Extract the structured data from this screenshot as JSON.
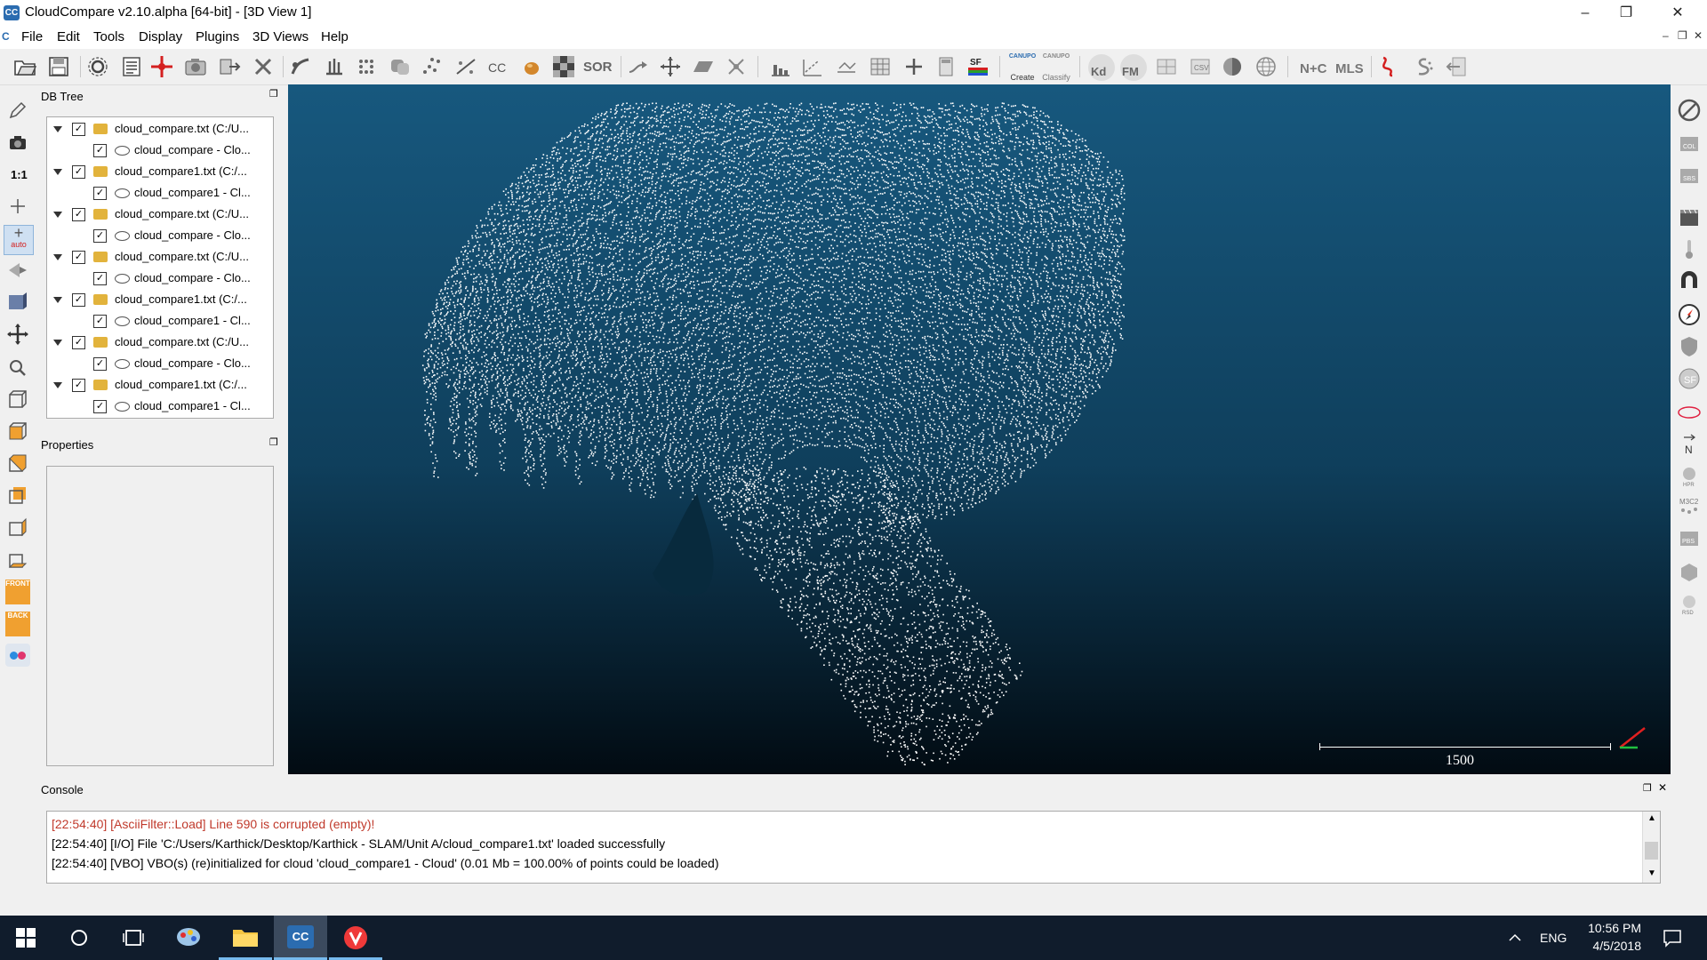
{
  "window": {
    "title": "CloudCompare v2.10.alpha [64-bit] - [3D View 1]",
    "app_icon_text": "CC"
  },
  "menu": [
    "File",
    "Edit",
    "Tools",
    "Display",
    "Plugins",
    "3D Views",
    "Help"
  ],
  "toolbar": {
    "sor_label": "SOR",
    "sf_label": "SF",
    "canupo_create_label": "Create",
    "canupo_classify_label": "Classify",
    "canupo_label": "CANUPO",
    "kd_label": "Kd",
    "fm_label": "FM",
    "nc_label": "N+C",
    "mls_label": "MLS"
  },
  "left_toolbar": {
    "scale_label": "1:1",
    "auto_label": "auto",
    "front_label": "FRONT",
    "back_label": "BACK"
  },
  "db_tree": {
    "title": "DB Tree",
    "items": [
      {
        "label": "cloud_compare.txt (C:/U...",
        "child": "cloud_compare - Clo..."
      },
      {
        "label": "cloud_compare1.txt (C:/...",
        "child": "cloud_compare1 - Cl..."
      },
      {
        "label": "cloud_compare.txt (C:/U...",
        "child": "cloud_compare - Clo..."
      },
      {
        "label": "cloud_compare.txt (C:/U...",
        "child": "cloud_compare - Clo..."
      },
      {
        "label": "cloud_compare1.txt (C:/...",
        "child": "cloud_compare1 - Cl..."
      },
      {
        "label": "cloud_compare.txt (C:/U...",
        "child": "cloud_compare - Clo..."
      },
      {
        "label": "cloud_compare1.txt (C:/...",
        "child": "cloud_compare1 - Cl..."
      }
    ]
  },
  "properties": {
    "title": "Properties"
  },
  "viewport": {
    "scale_label": "1500"
  },
  "console": {
    "title": "Console",
    "lines": [
      {
        "text": "[22:54:40] [AsciiFilter::Load] Line 590 is corrupted (empty)!",
        "color": "#c0392b"
      },
      {
        "text": "[22:54:40] [I/O] File 'C:/Users/Karthick/Desktop/Karthick - SLAM/Unit A/cloud_compare1.txt' loaded successfully",
        "color": "#000000"
      },
      {
        "text": "[22:54:40] [VBO] VBO(s) (re)initialized for cloud 'cloud_compare1 - Cloud' (0.01 Mb = 100.00% of points could be loaded)",
        "color": "#000000"
      }
    ]
  },
  "taskbar": {
    "language": "ENG",
    "time": "10:56 PM",
    "date": "4/5/2018"
  },
  "colors": {
    "accent": "#2b6cb0",
    "viewport_top": "#17587e",
    "viewport_bottom": "#020b12",
    "taskbar": "#101c2c"
  }
}
